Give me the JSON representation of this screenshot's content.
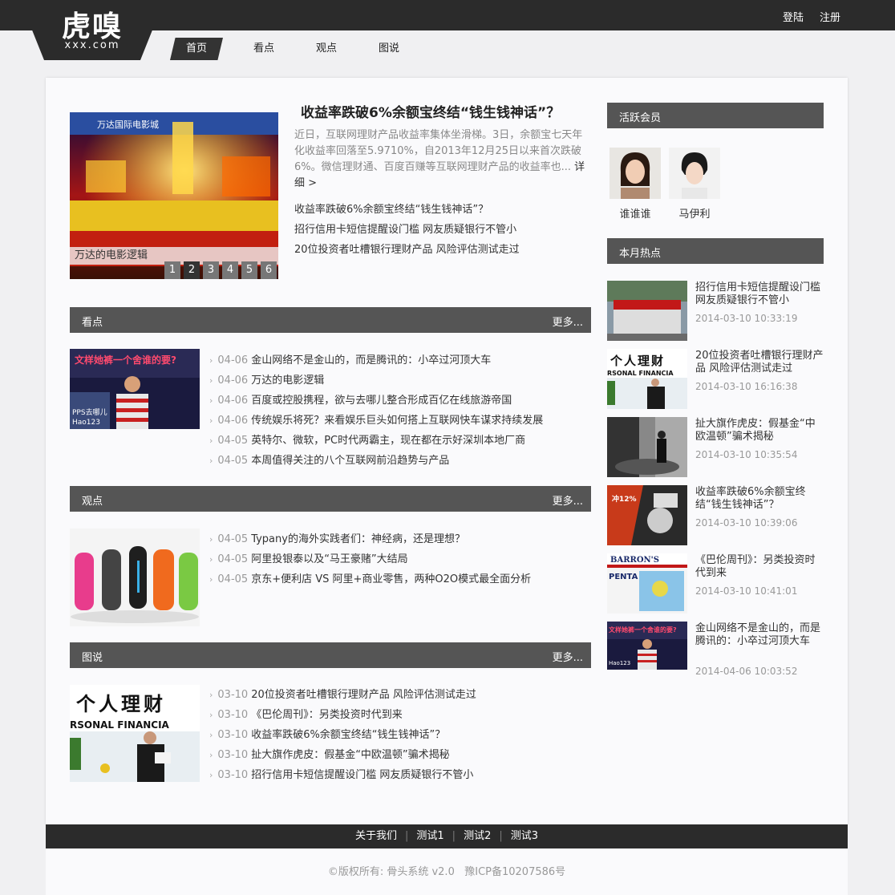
{
  "logo": {
    "main": "虎嗅",
    "sub": "xxx.com"
  },
  "auth": {
    "login": "登陆",
    "register": "注册"
  },
  "nav": [
    {
      "label": "首页",
      "active": true
    },
    {
      "label": "看点"
    },
    {
      "label": "观点"
    },
    {
      "label": "图说"
    }
  ],
  "slider": {
    "caption": "万达的电影逻辑",
    "pages": [
      "1",
      "2",
      "3",
      "4",
      "5",
      "6"
    ],
    "current": "2"
  },
  "featured": {
    "title": "收益率跌破6%余额宝终结“钱生钱神话”？",
    "summary": "近日，互联网理财产品收益率集体坐滑梯。3日，余额宝七天年化收益率回落至5.9710%，自2013年12月25日以来首次跌破6%。微信理财通、百度百赚等互联网理财产品的收益率也...",
    "more": "详细 >",
    "links": [
      "收益率跌破6%余额宝终结“钱生钱神话”？",
      "招行信用卡短信提醒设门槛 网友质疑银行不管小",
      "20位投资者吐槽银行理财产品 风险评估测试走过"
    ]
  },
  "sections": [
    {
      "title": "看点",
      "more": "更多...",
      "items": [
        {
          "date": "04-06",
          "text": "金山网络不是金山的，而是腾讯的：小卒过河顶大车"
        },
        {
          "date": "04-06",
          "text": "万达的电影逻辑"
        },
        {
          "date": "04-06",
          "text": "百度或控股携程，欲与去哪儿整合形成百亿在线旅游帝国"
        },
        {
          "date": "04-06",
          "text": "传统娱乐将死？来看娱乐巨头如何搭上互联网快车谋求持续发展"
        },
        {
          "date": "04-05",
          "text": "英特尔、微软，PC时代两霸主，现在都在示好深圳本地厂商"
        },
        {
          "date": "04-05",
          "text": "本周值得关注的八个互联网前沿趋势与产品"
        }
      ]
    },
    {
      "title": "观点",
      "more": "更多...",
      "items": [
        {
          "date": "04-05",
          "text": "Typany的海外实践者们：神经病，还是理想？"
        },
        {
          "date": "04-05",
          "text": "阿里投银泰以及“马王豪赌”大结局"
        },
        {
          "date": "04-05",
          "text": "京东+便利店 VS 阿里+商业零售，两种O2O模式最全面分析"
        }
      ]
    },
    {
      "title": "图说",
      "more": "更多...",
      "items": [
        {
          "date": "03-10",
          "text": "20位投资者吐槽银行理财产品 风险评估测试走过"
        },
        {
          "date": "03-10",
          "text": "《巴伦周刊》：另类投资时代到来"
        },
        {
          "date": "03-10",
          "text": "收益率跌破6%余额宝终结“钱生钱神话”？"
        },
        {
          "date": "03-10",
          "text": "扯大旗作虎皮：假基金“中欧温顿”骗术揭秘"
        },
        {
          "date": "03-10",
          "text": "招行信用卡短信提醒设门槛 网友质疑银行不管小"
        }
      ]
    }
  ],
  "sidebar": {
    "members_title": "活跃会员",
    "members": [
      {
        "name": "谁谁谁"
      },
      {
        "name": "马伊利"
      }
    ],
    "hot_title": "本月热点",
    "hot": [
      {
        "title": "招行信用卡短信提醒设门槛 网友质疑银行不管小",
        "time": "2014-03-10 10:33:19"
      },
      {
        "title": "20位投资者吐槽银行理财产品 风险评估测试走过",
        "time": "2014-03-10 16:16:38"
      },
      {
        "title": "扯大旗作虎皮：假基金“中欧温顿”骗术揭秘",
        "time": "2014-03-10 10:35:54"
      },
      {
        "title": "收益率跌破6%余额宝终结“钱生钱神话”？",
        "time": "2014-03-10 10:39:06"
      },
      {
        "title": "《巴伦周刊》：另类投资时代到来",
        "time": "2014-03-10 10:41:01"
      },
      {
        "title": "金山网络不是金山的，而是腾讯的：小卒过河顶大车",
        "time": "2014-04-06 10:03:52"
      }
    ]
  },
  "image_text": {
    "finance_sign": "个人理财",
    "finance_sub": "RSONAL FINANCIA",
    "banner_red": "文样她裤一个舍谁的要?",
    "hao123": "Hao123",
    "pps": "PPS去哪儿",
    "cinema": "万达国际电影城",
    "stamp": "冲12%",
    "barrons": "BARRON'S",
    "penta": "PENTA"
  },
  "footer": {
    "links": [
      "关于我们",
      "测试1",
      "测试2",
      "测试3"
    ],
    "copyright": "©版权所有: 骨头系统 v2.0   豫ICP备10207586号"
  },
  "colors": {
    "dark": "#2b2b2b",
    "section_header": "#555555",
    "background": "#f0f0f2"
  }
}
